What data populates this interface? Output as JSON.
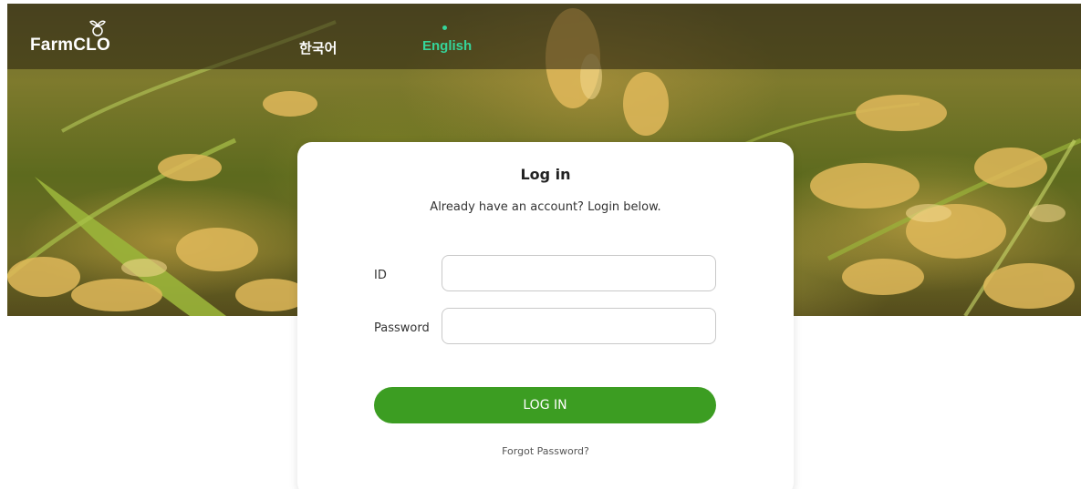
{
  "header": {
    "logo_text": "FarmCLO",
    "languages": [
      {
        "label": "한국어",
        "active": false
      },
      {
        "label": "English",
        "active": true
      }
    ]
  },
  "login": {
    "title": "Log in",
    "subtitle": "Already have an account? Login below.",
    "id_label": "ID",
    "id_value": "",
    "password_label": "Password",
    "password_value": "",
    "button_label": "LOG IN",
    "forgot_link": "Forgot Password?"
  },
  "colors": {
    "accent_green": "#3c9d22",
    "active_language": "#35d49a"
  },
  "icons": {
    "logo": "sprout-icon"
  }
}
